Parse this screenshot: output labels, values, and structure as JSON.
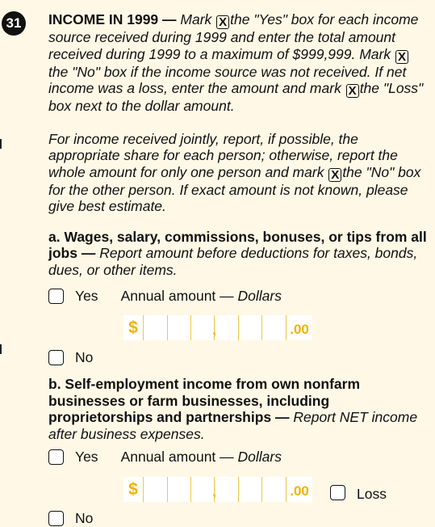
{
  "question": {
    "number": "31",
    "title": "INCOME IN 1999",
    "dash": " — ",
    "box_mark": "X",
    "intro_1": "Mark ",
    "intro_2": "the \"Yes\" box for each income source received during 1999 and enter the total amount received during 1999 to a maximum of $999,999. Mark ",
    "intro_3": "the \"No\" box if the income source was not received. If net income was a loss, enter the amount and mark ",
    "intro_4": "the \"Loss\" box next to the dollar amount.",
    "joint_1": "For income received jointly, report, if possible, the appropriate share for each person; otherwise, report the whole amount for only one person and mark ",
    "joint_2": "the \"No\" box for the other person. If exact amount is not known, please give best estimate."
  },
  "section_a": {
    "heading": "a. Wages, salary, commissions, bonuses, or tips from all jobs",
    "dash": " — ",
    "instruction": "Report amount before deductions for taxes, bonds, dues, or other items.",
    "yes_label": "Yes",
    "amount_label": "Annual amount — ",
    "amount_unit": "Dollars",
    "dollar_sign": "$",
    "comma": ",",
    "cents": ".00",
    "no_label": "No"
  },
  "section_b": {
    "heading": "b. Self-employment income from own nonfarm businesses or farm businesses, including proprietorships and partnerships",
    "dash": " — ",
    "instruction": "Report NET income after business expenses.",
    "yes_label": "Yes",
    "amount_label": "Annual amount — ",
    "amount_unit": "Dollars",
    "dollar_sign": "$",
    "comma": ",",
    "cents": ".00",
    "loss_label": "Loss",
    "no_label": "No"
  }
}
